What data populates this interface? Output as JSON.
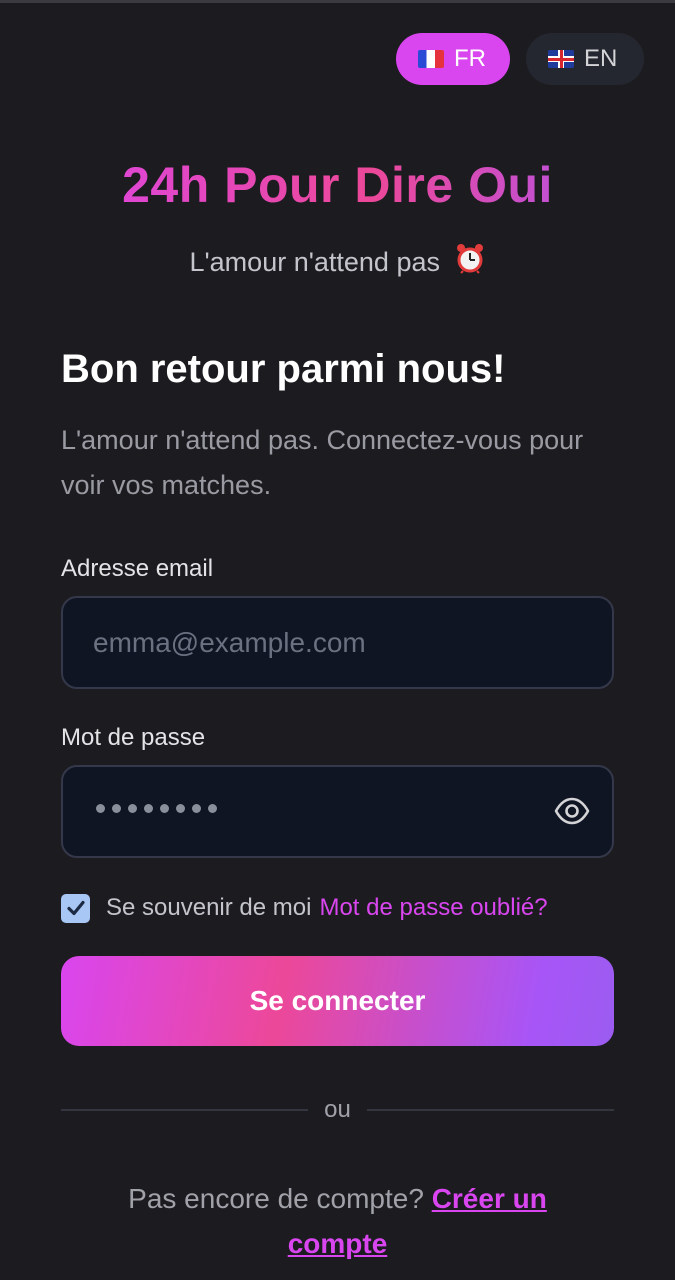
{
  "languages": [
    {
      "code": "FR",
      "flag": "flag-fr",
      "active": true
    },
    {
      "code": "EN",
      "flag": "flag-uk",
      "active": false
    }
  ],
  "brand": {
    "title": "24h Pour Dire Oui",
    "tagline": "L'amour n'attend pas",
    "tagline_icon": "alarm-clock-icon"
  },
  "login": {
    "heading": "Bon retour parmi nous!",
    "subtitle": "L'amour n'attend pas. Connectez-vous pour voir vos matches.",
    "email_label": "Adresse email",
    "email_placeholder": "emma@example.com",
    "password_label": "Mot de passe",
    "password_masked_length": 8,
    "remember_label": "Se souvenir de moi",
    "remember_checked": true,
    "forgot_link": "Mot de passe oublié?",
    "submit_label": "Se connecter",
    "divider_text": "ou",
    "signup_prompt": "Pas encore de compte?",
    "signup_link": "Créer un compte"
  },
  "colors": {
    "background": "#1c1c20",
    "accent": "#d946ef",
    "accent_pink": "#ec4899",
    "accent_purple": "#a855f7",
    "input_bg": "#0f1522"
  }
}
